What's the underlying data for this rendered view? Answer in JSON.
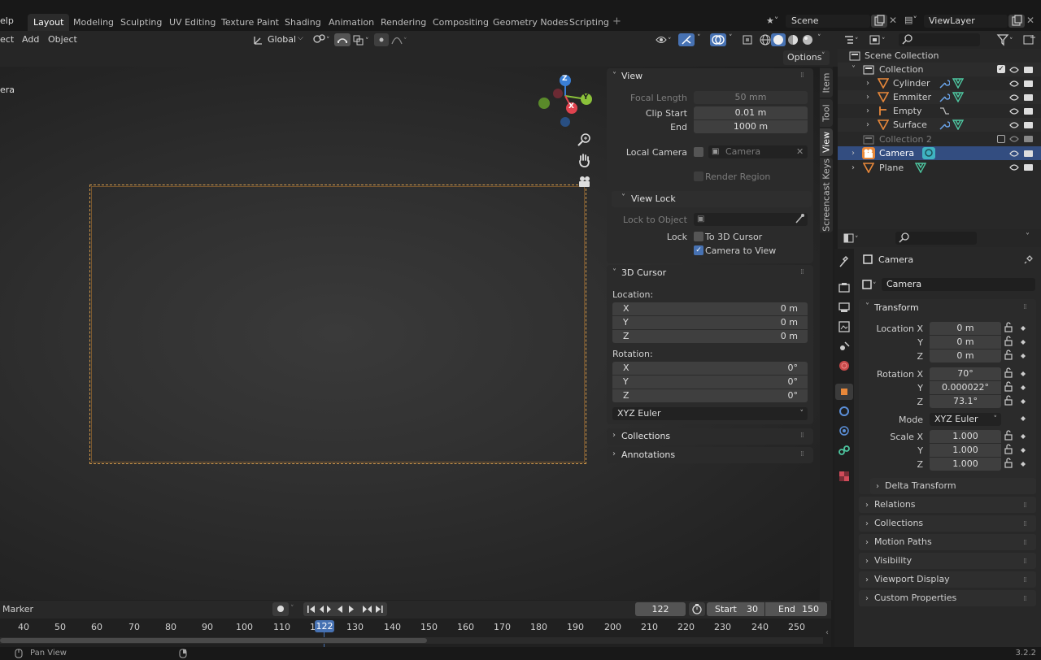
{
  "topbar": {
    "help_fragment": "elp",
    "tabs": [
      "Layout",
      "Modeling",
      "Sculpting",
      "UV Editing",
      "Texture Paint",
      "Shading",
      "Animation",
      "Rendering",
      "Compositing",
      "Geometry Nodes",
      "Scripting"
    ],
    "scene": "Scene",
    "view_layer": "ViewLayer"
  },
  "header": {
    "menu": [
      "ect",
      "Add",
      "Object"
    ],
    "orientation": "Global",
    "options": "Options"
  },
  "viewport": {
    "label_fragment": "era",
    "gizmo": {
      "z": "Z",
      "y": "Y",
      "x": "X"
    }
  },
  "vtabs": [
    "Item",
    "Tool",
    "View",
    "Screencast Keys"
  ],
  "view_panel": {
    "title": "View",
    "focal_length_label": "Focal Length",
    "focal_length": "50 mm",
    "clip_start_label": "Clip Start",
    "clip_start": "0.01 m",
    "end_label": "End",
    "end": "1000 m",
    "local_camera_label": "Local Camera",
    "local_camera_placeholder": "Camera",
    "render_region": "Render Region",
    "view_lock_title": "View Lock",
    "lock_to_object_label": "Lock to Object",
    "lock_label": "Lock",
    "to_3d_cursor": "To 3D Cursor",
    "camera_to_view": "Camera to View"
  },
  "cursor_panel": {
    "title": "3D Cursor",
    "location_label": "Location:",
    "location": [
      {
        "axis": "X",
        "value": "0 m"
      },
      {
        "axis": "Y",
        "value": "0 m"
      },
      {
        "axis": "Z",
        "value": "0 m"
      }
    ],
    "rotation_label": "Rotation:",
    "rotation": [
      {
        "axis": "X",
        "value": "0°"
      },
      {
        "axis": "Y",
        "value": "0°"
      },
      {
        "axis": "Z",
        "value": "0°"
      }
    ],
    "rotation_mode": "XYZ Euler"
  },
  "npanel_collapsed": [
    "Collections",
    "Annotations"
  ],
  "outliner": {
    "root": "Scene Collection",
    "rows": [
      {
        "name": "Collection",
        "indent": 1
      },
      {
        "name": "Cylinder",
        "indent": 2
      },
      {
        "name": "Emmiter",
        "indent": 2
      },
      {
        "name": "Empty",
        "indent": 2
      },
      {
        "name": "Surface",
        "indent": 2
      },
      {
        "name": "Collection 2",
        "indent": 1
      },
      {
        "name": "Camera",
        "indent": 1
      },
      {
        "name": "Plane",
        "indent": 1
      }
    ]
  },
  "properties": {
    "object_name": "Camera",
    "data_name": "Camera",
    "transform_title": "Transform",
    "location_x_label": "Location X",
    "location": [
      "0 m",
      "0 m",
      "0 m"
    ],
    "rotation_x_label": "Rotation X",
    "rotation": [
      "70°",
      "0.000022°",
      "73.1°"
    ],
    "mode_label": "Mode",
    "mode": "XYZ Euler",
    "scale_x_label": "Scale X",
    "scale": [
      "1.000",
      "1.000",
      "1.000"
    ],
    "y_label": "Y",
    "z_label": "Z",
    "delta_transform": "Delta Transform",
    "sections": [
      "Relations",
      "Collections",
      "Motion Paths",
      "Visibility",
      "Viewport Display",
      "Custom Properties"
    ]
  },
  "timeline": {
    "marker": "Marker",
    "current_frame": "122",
    "start_label": "Start",
    "start": "30",
    "end_label": "End",
    "end": "150",
    "ruler": [
      "40",
      "50",
      "60",
      "70",
      "80",
      "90",
      "100",
      "110",
      "1",
      "130",
      "140",
      "150",
      "160",
      "170",
      "180",
      "190",
      "200",
      "210",
      "220",
      "230",
      "240",
      "250"
    ],
    "playhead": "122"
  },
  "statusbar": {
    "pan_view": "Pan View",
    "version": "3.2.2"
  },
  "colors": {
    "accent_blue": "#4772b3",
    "selection_outline": "#d49a4a",
    "gizmo_x": "#e0434f",
    "gizmo_y": "#8bc13a",
    "gizmo_z": "#3a7fd6"
  }
}
